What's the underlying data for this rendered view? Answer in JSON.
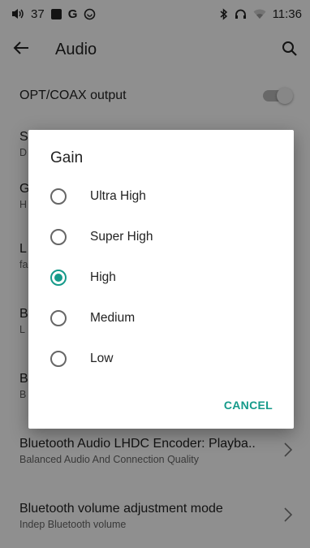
{
  "status_bar": {
    "volume": "37",
    "time": "11:36",
    "left_icons": [
      "volume-icon",
      "image-icon",
      "google-icon",
      "sync-icon"
    ],
    "right_icons": [
      "bluetooth-icon",
      "headphones-icon",
      "wifi-icon"
    ]
  },
  "app_bar": {
    "title": "Audio"
  },
  "settings": [
    {
      "title": "OPT/COAX output",
      "subtitle": "",
      "control": "toggle"
    },
    {
      "title": "S",
      "subtitle": "D",
      "control": "none"
    },
    {
      "title": "G",
      "subtitle": "H",
      "control": "none"
    },
    {
      "title": "L",
      "subtitle": "fa",
      "control": "none"
    },
    {
      "title": "B",
      "subtitle": "L",
      "control": "none"
    },
    {
      "title": "B",
      "subtitle": "B",
      "control": "none"
    },
    {
      "title": "Bluetooth Audio LHDC Encoder: Playba..",
      "subtitle": "Balanced Audio And Connection Quality",
      "control": "chevron"
    },
    {
      "title": "Bluetooth volume adjustment mode",
      "subtitle": "Indep Bluetooth volume",
      "control": "chevron"
    }
  ],
  "dialog": {
    "title": "Gain",
    "options": [
      {
        "label": "Ultra High",
        "selected": false
      },
      {
        "label": "Super High",
        "selected": false
      },
      {
        "label": "High",
        "selected": true
      },
      {
        "label": "Medium",
        "selected": false
      },
      {
        "label": "Low",
        "selected": false
      }
    ],
    "cancel_label": "CANCEL"
  },
  "colors": {
    "accent": "#159a8a"
  }
}
